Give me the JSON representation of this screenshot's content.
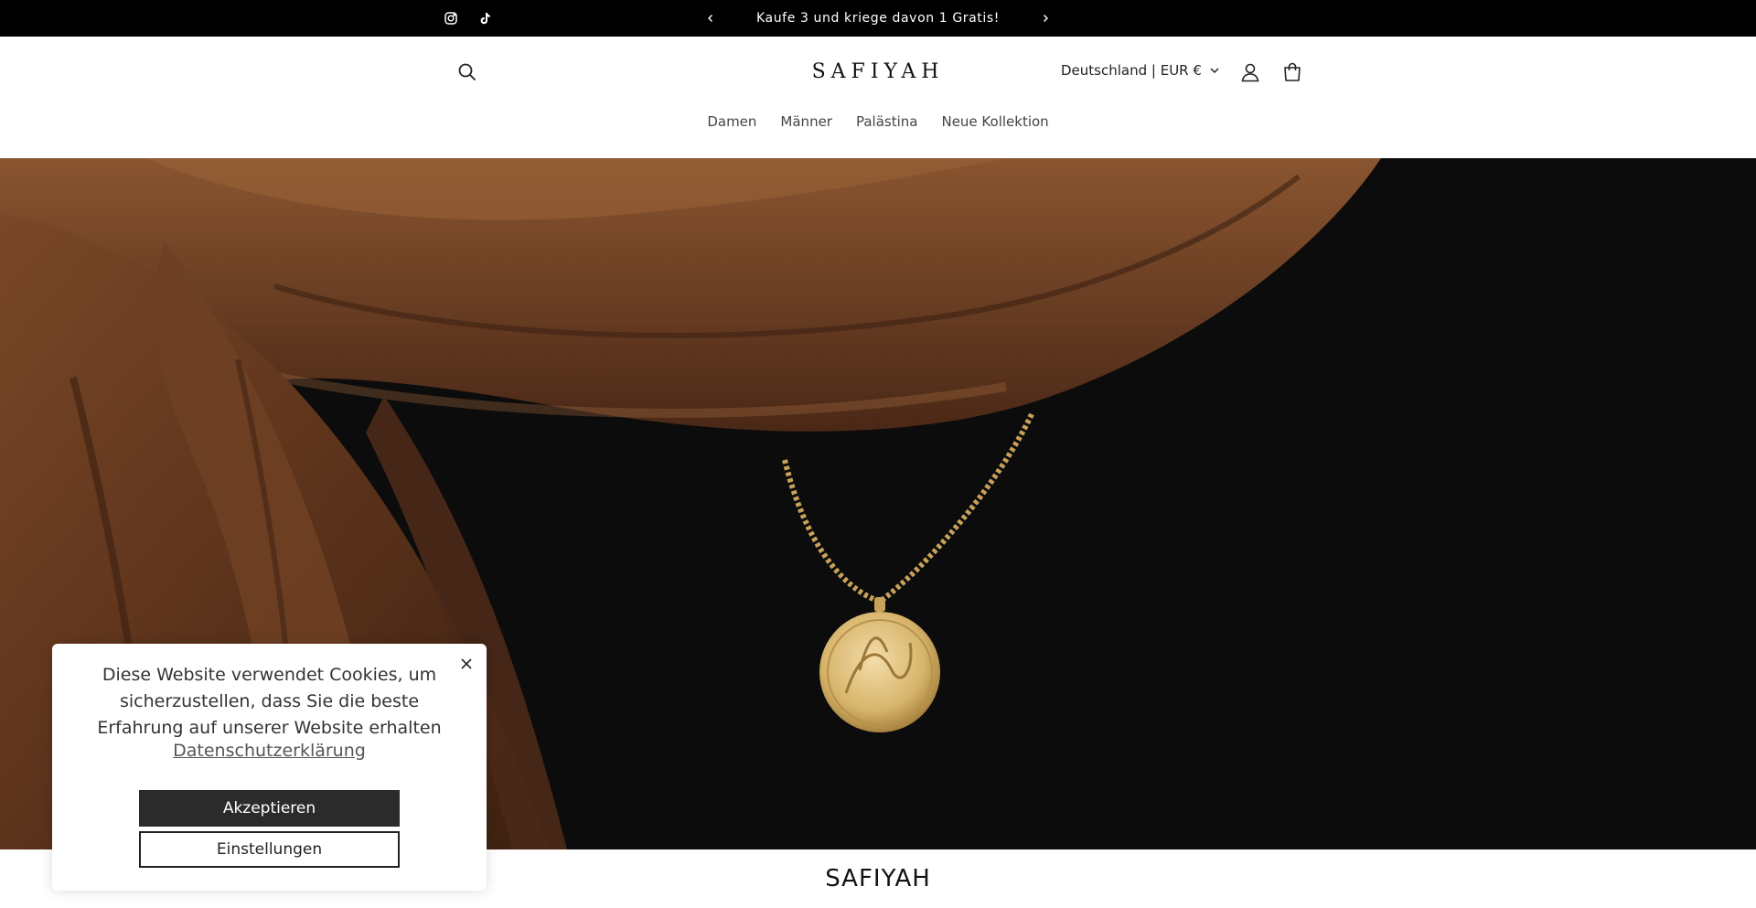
{
  "announcement": {
    "text": "Kaufe 3 und kriege davon 1 Gratis!"
  },
  "social": {
    "icons": [
      "instagram-icon",
      "tiktok-icon"
    ]
  },
  "header": {
    "logo": "SAFIYAH",
    "country_selector": "Deutschland | EUR €"
  },
  "nav": {
    "items": [
      "Damen",
      "Männer",
      "Palästina",
      "Neue Kollektion"
    ]
  },
  "section": {
    "title": "SAFIYAH"
  },
  "cookie": {
    "text": "Diese Website verwendet Cookies, um sicherzustellen, dass Sie die beste Erfahrung auf unserer Website erhalten",
    "link": "Datenschutzerklärung",
    "accept": "Akzeptieren",
    "settings": "Einstellungen"
  },
  "colors": {
    "topbar": "#000000",
    "accent_dark": "#2b2b2b",
    "scarf": "#6b3d22",
    "gold": "#d6b46a"
  }
}
